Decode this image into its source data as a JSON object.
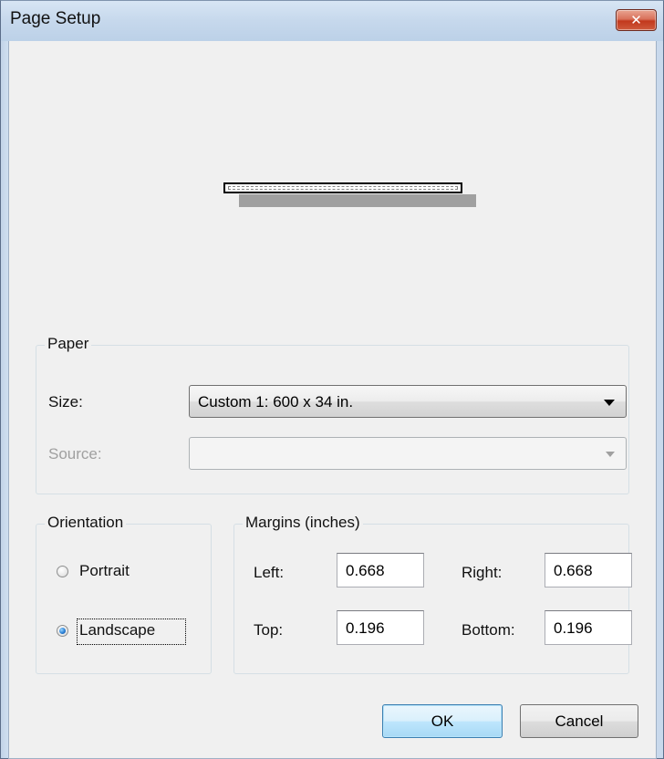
{
  "window": {
    "title": "Page Setup"
  },
  "paper": {
    "group_label": "Paper",
    "size_label": "Size:",
    "size_value": "Custom 1: 600 x 34 in.",
    "source_label": "Source:",
    "source_value": ""
  },
  "orientation": {
    "group_label": "Orientation",
    "options": [
      {
        "label": "Portrait",
        "checked": false
      },
      {
        "label": "Landscape",
        "checked": true
      }
    ]
  },
  "margins": {
    "group_label": "Margins (inches)",
    "left_label": "Left:",
    "left_value": "0.668",
    "right_label": "Right:",
    "right_value": "0.668",
    "top_label": "Top:",
    "top_value": "0.196",
    "bottom_label": "Bottom:",
    "bottom_value": "0.196"
  },
  "buttons": {
    "ok": "OK",
    "cancel": "Cancel"
  },
  "icons": {
    "close": "close-icon"
  },
  "colors": {
    "close_button": "#c2391d",
    "default_button_border": "#3c7fb1",
    "radio_selected": "#2b7fd4"
  }
}
